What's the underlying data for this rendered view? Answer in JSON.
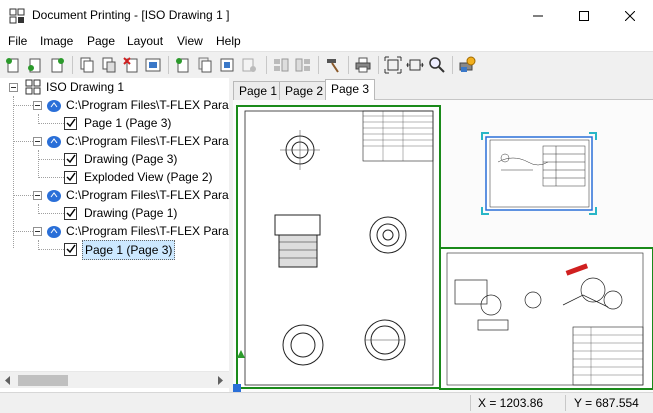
{
  "window": {
    "title": "Document Printing - [ISO Drawing 1 ]",
    "minimize_icon": "minimize-icon",
    "maximize_icon": "maximize-icon",
    "close_icon": "close-icon"
  },
  "menu": [
    "File",
    "Image",
    "Page",
    "Layout",
    "View",
    "Help"
  ],
  "toolbar": {
    "icons": [
      "new-document-icon",
      "add-page-icon",
      "insert-page-icon",
      "copy-page-icon",
      "paste-page-icon",
      "delete-page-icon",
      "page-properties-icon",
      "new-sheet-icon",
      "duplicate-sheet-icon",
      "sheet-settings-icon",
      "disabled-sheet-icon",
      "arrange-left-icon",
      "arrange-right-icon",
      "hammer-icon",
      "print-icon",
      "fit-page-icon",
      "fit-width-icon",
      "zoom-icon",
      "printer-settings-icon"
    ]
  },
  "tree": {
    "root": "ISO Drawing 1",
    "groups": [
      {
        "file": "C:\\Program Files\\T-FLEX Parar",
        "pages": [
          "Page 1 (Page 3)"
        ]
      },
      {
        "file": "C:\\Program Files\\T-FLEX Parar",
        "pages": [
          "Drawing (Page 3)",
          "Exploded View (Page 2)"
        ]
      },
      {
        "file": "C:\\Program Files\\T-FLEX Parar",
        "pages": [
          "Drawing (Page 1)"
        ]
      },
      {
        "file": "C:\\Program Files\\T-FLEX Parar",
        "pages": [
          "Page 1 (Page 3)"
        ]
      }
    ]
  },
  "tabs": [
    "Page 1",
    "Page 2",
    "Page 3"
  ],
  "active_tab": "Page 3",
  "status": {
    "x": "X = 1203.86",
    "y": "Y = 687.554"
  },
  "colors": {
    "frame_green": "#1a8a1a",
    "selection_blue": "#2a6fd8",
    "handle_cyan": "#29b6c7",
    "part_red": "#d02020"
  }
}
